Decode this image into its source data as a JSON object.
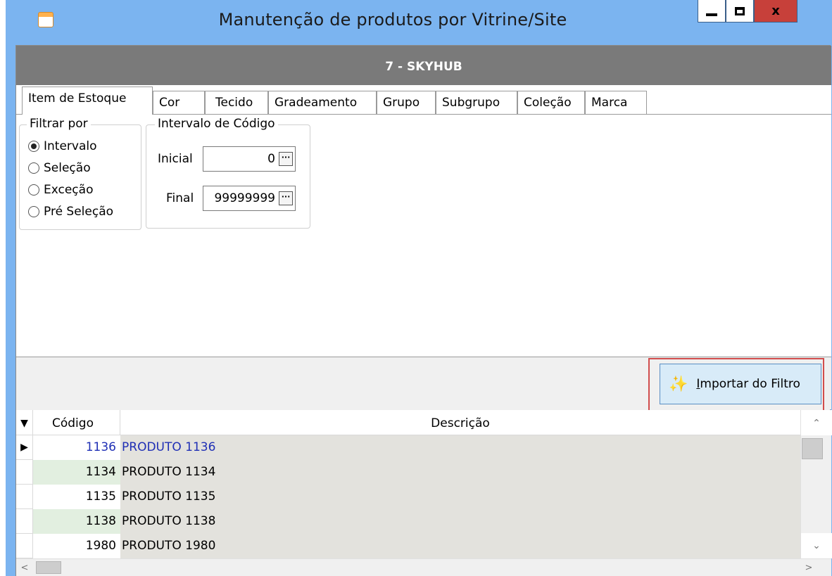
{
  "window": {
    "title": "Manutenção de produtos por Vitrine/Site",
    "close_label": "x"
  },
  "store": {
    "header": "7 - SKYHUB"
  },
  "tabs": [
    {
      "label": "Item de Estoque",
      "active": true
    },
    {
      "label": "Cor"
    },
    {
      "label": "Tecido"
    },
    {
      "label": "Gradeamento"
    },
    {
      "label": "Grupo"
    },
    {
      "label": "Subgrupo"
    },
    {
      "label": "Coleção"
    },
    {
      "label": "Marca"
    }
  ],
  "filter": {
    "legend": "Filtrar por",
    "options": [
      {
        "label": "Intervalo",
        "checked": true
      },
      {
        "label": "Seleção"
      },
      {
        "label": "Exceção"
      },
      {
        "label": "Pré Seleção"
      }
    ]
  },
  "range": {
    "legend": "Intervalo de Código",
    "initial_label": "Inicial",
    "initial_value": "0",
    "final_label": "Final",
    "final_value": "99999999",
    "ellipsis": "···"
  },
  "import_button": {
    "label_hotkey": "I",
    "label_rest": "mportar do Filtro"
  },
  "grid": {
    "indicator_header": "▼",
    "columns": [
      "Código",
      "Descrição"
    ],
    "current_marker": "▶",
    "rows": [
      {
        "code": "1136",
        "description": "PRODUTO 1136"
      },
      {
        "code": "1134",
        "description": "PRODUTO 1134"
      },
      {
        "code": "1135",
        "description": "PRODUTO 1135"
      },
      {
        "code": "1138",
        "description": "PRODUTO 1138"
      },
      {
        "code": "1980",
        "description": "PRODUTO 1980"
      }
    ]
  },
  "scrollbars": {
    "up": "⌃",
    "down": "⌄",
    "left": "<",
    "right": ">"
  }
}
